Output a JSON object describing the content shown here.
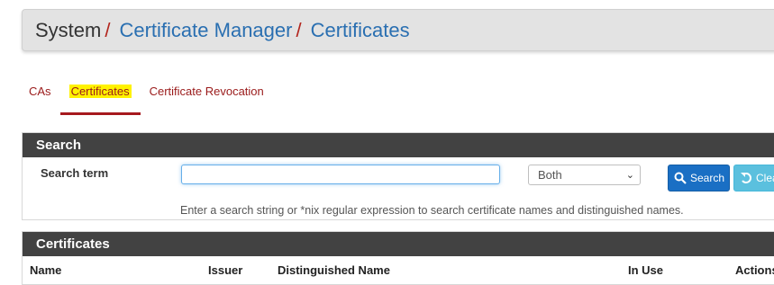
{
  "breadcrumb": {
    "root": "System",
    "items": [
      "Certificate Manager",
      "Certificates"
    ],
    "separator": "/"
  },
  "tabs": [
    {
      "label": "CAs",
      "active": false
    },
    {
      "label": "Certificates",
      "active": true
    },
    {
      "label": "Certificate Revocation",
      "active": false
    }
  ],
  "search": {
    "heading": "Search",
    "label": "Search term",
    "value": "",
    "scope_selected": "Both",
    "search_button": "Search",
    "clear_button": "Clear",
    "help": "Enter a search string or *nix regular expression to search certificate names and distinguished names."
  },
  "certificates": {
    "heading": "Certificates",
    "columns": [
      "Name",
      "Issuer",
      "Distinguished Name",
      "In Use",
      "Actions"
    ]
  },
  "colors": {
    "accent_red": "#a6191e",
    "link_blue": "#2a6fb1",
    "panel_header": "#424242",
    "highlight": "#fff200",
    "primary_button": "#1a6fc4",
    "info_button": "#5bc0de"
  }
}
